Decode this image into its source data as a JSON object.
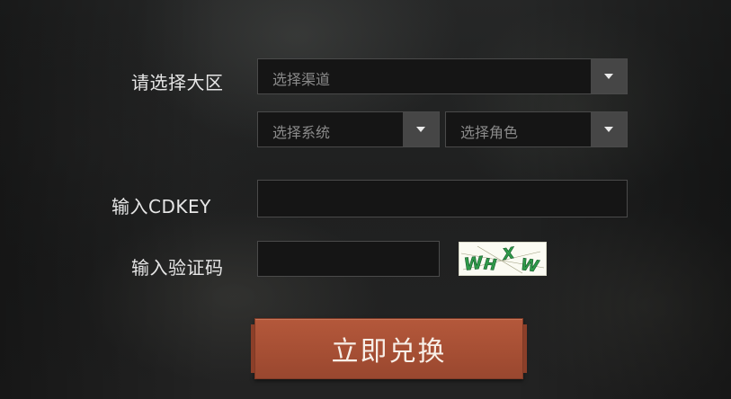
{
  "form": {
    "region_label": "请选择大区",
    "channel_select": {
      "placeholder": "选择渠道",
      "icon": "chevron-down-icon"
    },
    "system_select": {
      "placeholder": "选择系统",
      "icon": "chevron-down-icon"
    },
    "role_select": {
      "placeholder": "选择角色",
      "icon": "chevron-down-icon"
    },
    "cdkey_label": "输入CDKEY",
    "cdkey_value": "",
    "captcha_label": "输入验证码",
    "captcha_value": "",
    "captcha_text": "WHXW",
    "submit_label": "立即兑换"
  },
  "colors": {
    "submit": "#a64f34",
    "field_bg": "#151515",
    "arrow_bg": "#464646",
    "captcha_text": "#2f9a4a"
  }
}
